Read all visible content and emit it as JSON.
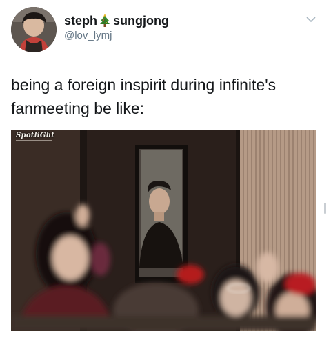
{
  "tweet": {
    "author": {
      "name_first": "steph",
      "name_emoji": "christmas-tree-icon",
      "name_second": "sungjong",
      "handle": "@lov_lymj"
    },
    "text": "being a foreign inspirit during infinite's fanmeeting be like:",
    "media": {
      "watermark": "SpotliGht"
    }
  },
  "colors": {
    "text": "#14171a",
    "secondary": "#657786",
    "tree_green": "#3a8a2e",
    "chevron": "#aab8c2"
  }
}
